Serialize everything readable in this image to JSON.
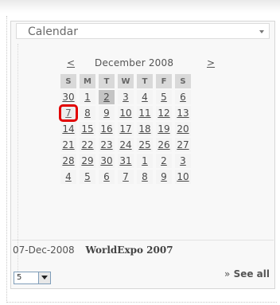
{
  "widget": {
    "title": "Calendar",
    "chevron_icon": "chevron-down-icon"
  },
  "calendar": {
    "prev_label": "<",
    "month_title": "December 2008",
    "next_label": ">",
    "weekdays": [
      "S",
      "M",
      "T",
      "W",
      "T",
      "F",
      "S"
    ],
    "weeks": [
      [
        "30",
        "1",
        "2",
        "3",
        "4",
        "5",
        "6"
      ],
      [
        "7",
        "8",
        "9",
        "10",
        "11",
        "12",
        "13"
      ],
      [
        "14",
        "15",
        "16",
        "17",
        "18",
        "19",
        "20"
      ],
      [
        "21",
        "22",
        "23",
        "24",
        "25",
        "26",
        "27"
      ],
      [
        "28",
        "29",
        "30",
        "31",
        "1",
        "2",
        "3"
      ],
      [
        "4",
        "5",
        "6",
        "7",
        "8",
        "9",
        "10"
      ]
    ],
    "today_day": "2",
    "selected_day": "7",
    "selected_color": "#e20000"
  },
  "event": {
    "date": "07-Dec-2008",
    "title": "WorldExpo 2007"
  },
  "footer": {
    "select_value": "5",
    "see_all_prefix": "»",
    "see_all_label": "See all"
  }
}
